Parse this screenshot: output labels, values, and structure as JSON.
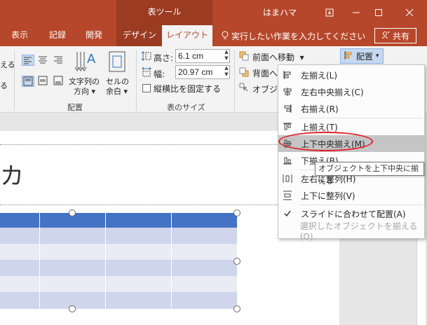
{
  "titlebar": {
    "context_header": "表ツール",
    "user": "はまハマ",
    "icons": [
      "ribbon-display-options-icon",
      "minimize-icon",
      "maximize-icon",
      "close-icon"
    ]
  },
  "tabs": {
    "items": [
      {
        "label": "表示"
      },
      {
        "label": "記録"
      },
      {
        "label": "開発"
      },
      {
        "label": "デザイン"
      },
      {
        "label": "レイアウト",
        "active": true
      }
    ],
    "tell_me": "実行したい作業を入力してください",
    "share": "共有"
  },
  "ribbon": {
    "left_cut_1": "える",
    "left_cut_2": "る",
    "text_direction_1": "文字列の",
    "text_direction_2": "方向",
    "cell_margin_1": "セルの",
    "cell_margin_2": "余白",
    "alignment_group": "配置",
    "height_label": "高さ:",
    "height_value": "6.1 cm",
    "width_label": "幅:",
    "width_value": "20.97 cm",
    "lock_ratio": "縦横比を固定する",
    "table_size_group": "表のサイズ",
    "bring_forward": "前面へ移動",
    "send_backward": "背面へ",
    "selection_pane": "オブジェ",
    "arrange": "配置"
  },
  "slide": {
    "title_fragment": "カ"
  },
  "menu": {
    "items": [
      {
        "label": "左揃え(L)",
        "icon": "align-left-icon"
      },
      {
        "label": "左右中央揃え(C)",
        "icon": "align-center-icon"
      },
      {
        "label": "右揃え(R)",
        "icon": "align-right-icon"
      },
      {
        "label": "上揃え(T)",
        "icon": "align-top-icon"
      },
      {
        "label": "上下中央揃え(M)",
        "icon": "align-middle-icon",
        "highlighted": true
      },
      {
        "label": "下揃え(B)",
        "icon": "align-bottom-icon"
      },
      {
        "label": "左右に整列(H)",
        "icon": "distribute-horizontal-icon"
      },
      {
        "label": "上下に整列(V)",
        "icon": "distribute-vertical-icon"
      },
      {
        "label": "スライドに合わせて配置(A)",
        "icon": "check-icon"
      },
      {
        "label": "選択したオブジェクトを揃える(O)",
        "disabled": true
      }
    ],
    "tooltip": "オブジェクトを上下中央に揃える"
  },
  "colors": {
    "accent": "#b7472a",
    "context_tab": "#9b3b22",
    "table_header": "#4472c4",
    "highlight_oval": "#e0202a"
  }
}
